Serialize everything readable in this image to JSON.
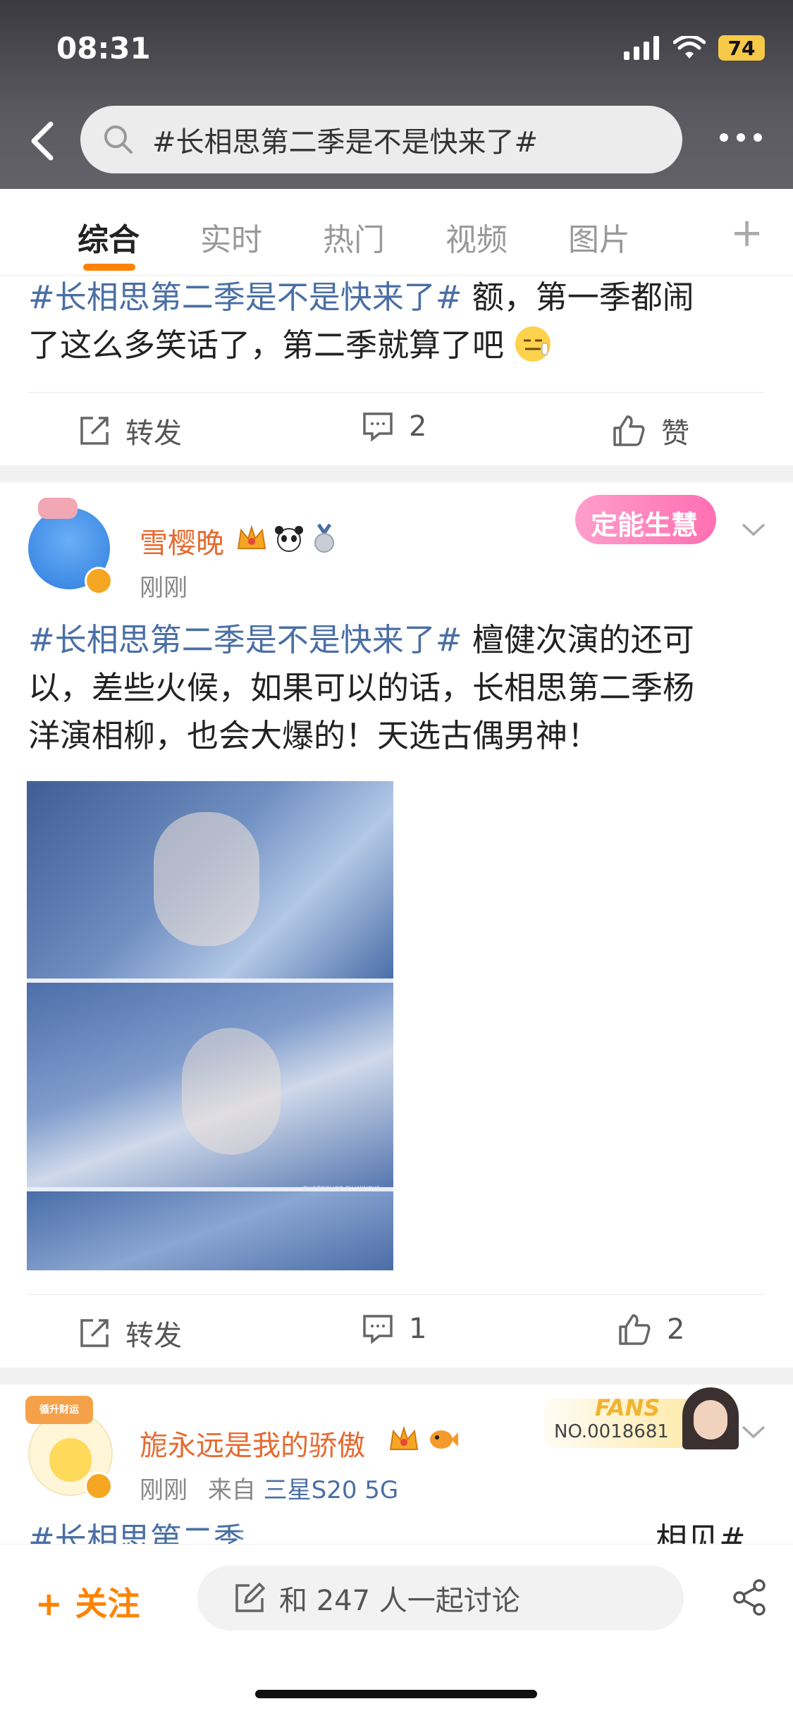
{
  "status_bar": {
    "time": "08:31",
    "battery": "74"
  },
  "search": {
    "query": "#长相思第二季是不是快来了#"
  },
  "tabs": [
    {
      "label": "综合",
      "active": true
    },
    {
      "label": "实时"
    },
    {
      "label": "热门"
    },
    {
      "label": "视频"
    },
    {
      "label": "图片"
    }
  ],
  "post1": {
    "topic": "#长相思第二季是不是快来了#",
    "text_line1": " 额，第一季都闹",
    "text_line2": "了这么多笑话了，第二季就算了吧",
    "repost_label": "转发",
    "comments": "2",
    "like_label": "赞"
  },
  "post2": {
    "username": "雪樱晚",
    "time": "刚刚",
    "sticker": "定能生慧",
    "topic": "#长相思第二季是不是快来了#",
    "text_line1": " 檀健次演的还可",
    "text_line2": "以，差些火候，如果可以的话，长相思第二季杨",
    "text_line3": "洋演相柳，也会大爆的！天选古偶男神！",
    "image_watermark": "PHOTOSHOP BY WINDY1",
    "repost_label": "转发",
    "comments": "1",
    "likes": "2"
  },
  "post3": {
    "username": "旎永远是我的骄傲",
    "time": "刚刚",
    "source": "来自",
    "device": "三星S20 5G",
    "fans_label": "FANS",
    "fans_no": "NO.0018681",
    "avatar_sticker": "循升财运",
    "topic_partial": "#长相思第二季",
    "text_partial": "相见#"
  },
  "bottom_bar": {
    "follow_label": "关注",
    "follow_icon": "+",
    "discuss_label": "和 247 人一起讨论"
  },
  "colors": {
    "accent": "#ff8200",
    "topic": "#4a6fa5",
    "username": "#e56a2f"
  }
}
